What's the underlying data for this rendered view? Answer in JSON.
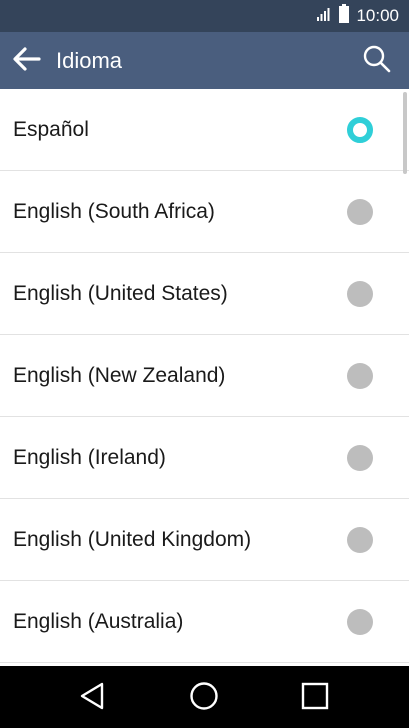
{
  "status_bar": {
    "time": "10:00",
    "icons": [
      "signal-icon",
      "battery-icon"
    ]
  },
  "app_bar": {
    "title": "Idioma",
    "back_icon": "arrow-left-icon",
    "search_icon": "search-icon"
  },
  "languages": [
    {
      "label": "Español",
      "selected": true
    },
    {
      "label": "English (South Africa)",
      "selected": false
    },
    {
      "label": "English (United States)",
      "selected": false
    },
    {
      "label": "English (New Zealand)",
      "selected": false
    },
    {
      "label": "English (Ireland)",
      "selected": false
    },
    {
      "label": "English (United Kingdom)",
      "selected": false
    },
    {
      "label": "English (Australia)",
      "selected": false
    }
  ],
  "nav_bar": {
    "buttons": [
      "back-triangle-icon",
      "home-circle-icon",
      "recents-square-icon"
    ]
  },
  "colors": {
    "status_bar": "#34445a",
    "app_bar": "#4a5e7e",
    "radio_selected": "#2fcfd8",
    "radio_unselected": "#bdbdbd"
  }
}
